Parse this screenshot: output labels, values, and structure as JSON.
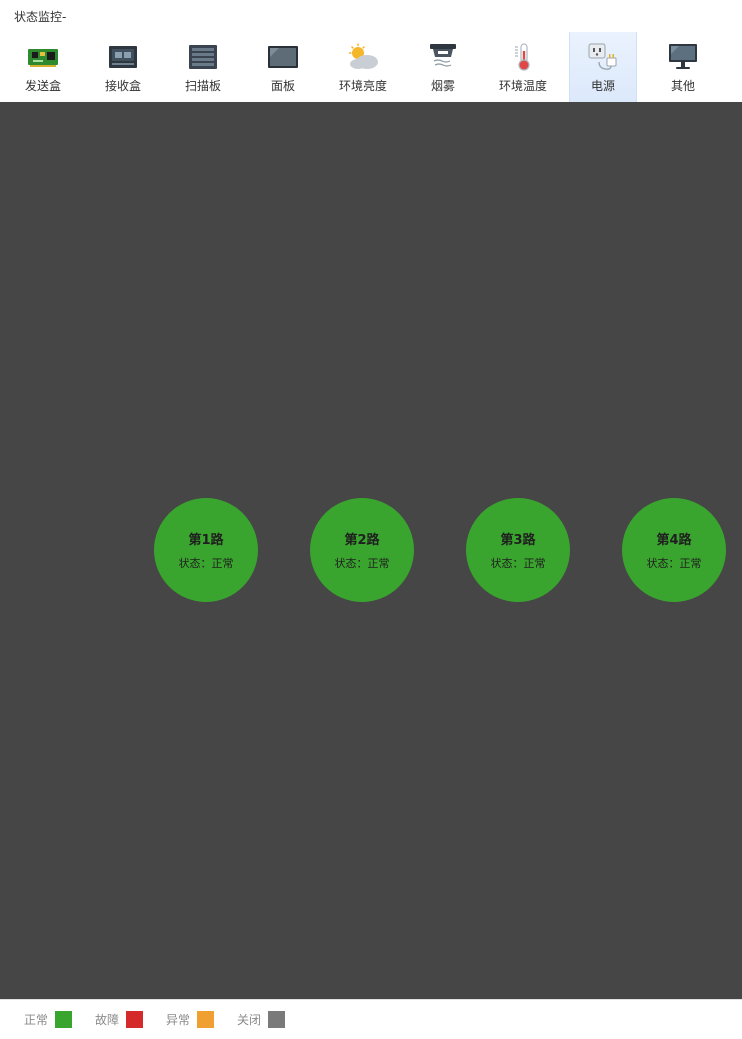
{
  "window": {
    "title": "状态监控-"
  },
  "toolbar": {
    "items": [
      {
        "label": "发送盒",
        "icon": "sending-card-icon"
      },
      {
        "label": "接收盒",
        "icon": "receiving-card-icon"
      },
      {
        "label": "扫描板",
        "icon": "scan-board-icon"
      },
      {
        "label": "面板",
        "icon": "panel-icon"
      },
      {
        "label": "环境亮度",
        "icon": "weather-icon"
      },
      {
        "label": "烟雾",
        "icon": "smoke-detector-icon"
      },
      {
        "label": "环境温度",
        "icon": "thermometer-icon"
      },
      {
        "label": "电源",
        "icon": "power-plug-icon",
        "active": true
      },
      {
        "label": "其他",
        "icon": "monitor-icon"
      }
    ]
  },
  "circuits": [
    {
      "name": "第1路",
      "status": "状态：正常"
    },
    {
      "name": "第2路",
      "status": "状态：正常"
    },
    {
      "name": "第3路",
      "status": "状态：正常"
    },
    {
      "name": "第4路",
      "status": "状态：正常"
    }
  ],
  "legend": [
    {
      "label": "正常",
      "color": "#3aa52e"
    },
    {
      "label": "故障",
      "color": "#d42a2a"
    },
    {
      "label": "异常",
      "color": "#f0a030"
    },
    {
      "label": "关闭",
      "color": "#7a7a7a"
    }
  ],
  "colors": {
    "canvas_background": "#464646",
    "normal": "#3aa52e",
    "active_tab": "#dce9fb"
  }
}
